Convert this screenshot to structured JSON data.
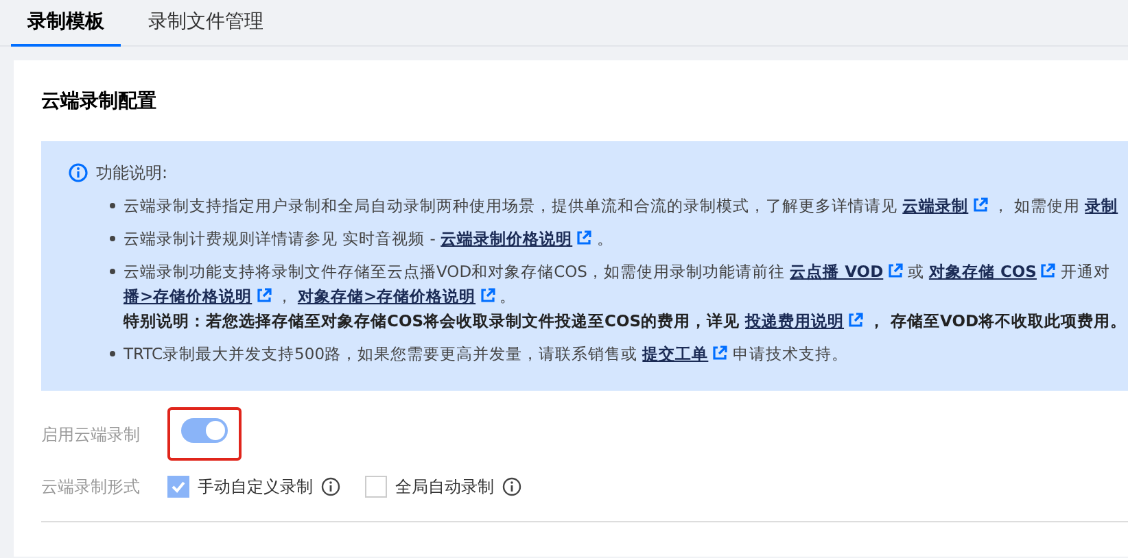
{
  "tabs": [
    {
      "label": "录制模板",
      "selected": true
    },
    {
      "label": "录制文件管理",
      "selected": false
    }
  ],
  "section_title": "云端录制配置",
  "notice": {
    "title": "功能说明:",
    "bullets": [
      {
        "lines": [
          {
            "bold": false,
            "segments": [
              {
                "text": "云端录制支持指定用户录制和全局自动录制两种使用场景，提供单流和合流的录制模式，了解更多详情请见 ",
                "link": false
              },
              {
                "text": "云端录制",
                "link": true,
                "external": true
              },
              {
                "text": " ， 如需使用 ",
                "link": false
              },
              {
                "text": "录制",
                "link": true,
                "external": false
              }
            ]
          }
        ]
      },
      {
        "lines": [
          {
            "bold": false,
            "segments": [
              {
                "text": "云端录制计费规则详情请参见 实时音视频 - ",
                "link": false
              },
              {
                "text": "云端录制价格说明",
                "link": true,
                "external": true
              },
              {
                "text": " 。",
                "link": false
              }
            ]
          }
        ]
      },
      {
        "lines": [
          {
            "bold": false,
            "segments": [
              {
                "text": "云端录制功能支持将录制文件存储至云点播VOD和对象存储COS，如需使用录制功能请前往 ",
                "link": false
              },
              {
                "text": "云点播 VOD",
                "link": true,
                "external": true
              },
              {
                "text": " 或 ",
                "link": false
              },
              {
                "text": "对象存储 COS",
                "link": true,
                "external": true
              },
              {
                "text": " 开通对",
                "link": false
              }
            ]
          },
          {
            "bold": false,
            "segments": [
              {
                "text": "播>存储价格说明",
                "link": true,
                "external": true
              },
              {
                "text": " ， ",
                "link": false
              },
              {
                "text": "对象存储>存储价格说明",
                "link": true,
                "external": true
              },
              {
                "text": " 。",
                "link": false
              }
            ]
          },
          {
            "bold": true,
            "segments": [
              {
                "text": "特别说明：若您选择存储至对象存储COS将会收取录制文件投递至COS的费用，详见 ",
                "link": false
              },
              {
                "text": "投递费用说明",
                "link": true,
                "external": true
              },
              {
                "text": " ， 存储至VOD将不收取此项费用。",
                "link": false
              }
            ]
          }
        ]
      },
      {
        "lines": [
          {
            "bold": false,
            "segments": [
              {
                "text": "TRTC录制最大并发支持500路，如果您需要更高并发量，请联系销售或 ",
                "link": false
              },
              {
                "text": "提交工单",
                "link": true,
                "external": true
              },
              {
                "text": " 申请技术支持。",
                "link": false
              }
            ]
          }
        ]
      }
    ]
  },
  "enable": {
    "label": "启用云端录制",
    "on": true,
    "highlighted": true
  },
  "mode": {
    "label": "云端录制形式",
    "options": [
      {
        "label": "手动自定义录制",
        "checked": true
      },
      {
        "label": "全局自动录制",
        "checked": false
      }
    ]
  }
}
